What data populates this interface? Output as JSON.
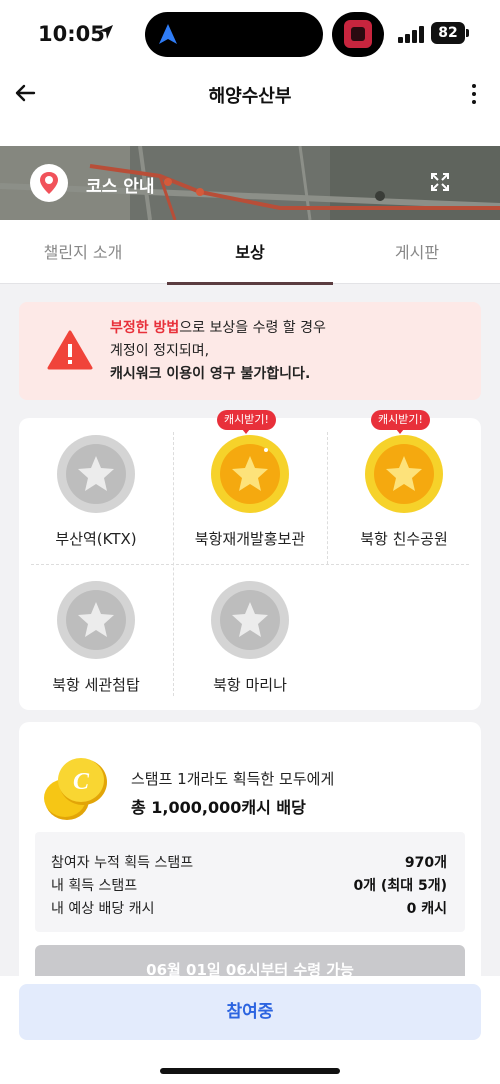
{
  "status_bar": {
    "time": "10:05",
    "battery": "82"
  },
  "header": {
    "title": "해양수산부"
  },
  "map_banner": {
    "label": "코스 안내"
  },
  "tabs": [
    {
      "label": "챌린지 소개",
      "active": false
    },
    {
      "label": "보상",
      "active": true
    },
    {
      "label": "게시판",
      "active": false
    }
  ],
  "warning": {
    "red": "부정한 방법",
    "line1_rest": "으로 보상을 수령 할 경우",
    "line2": "계정이 정지되며,",
    "line3": "캐시워크 이용이 영구 불가합니다."
  },
  "stamps": [
    {
      "label": "부산역(KTX)",
      "status": "locked",
      "badge": ""
    },
    {
      "label": "북항재개발홍보관",
      "status": "earned",
      "badge": "캐시받기!"
    },
    {
      "label": "북항 친수공원",
      "status": "earned",
      "badge": "캐시받기!"
    },
    {
      "label": "북항 세관첨탑",
      "status": "locked",
      "badge": ""
    },
    {
      "label": "북항 마리나",
      "status": "locked",
      "badge": ""
    }
  ],
  "reward": {
    "line1": "스탬프 1개라도 획득한 모두에게",
    "line2": "총 1,000,000캐시 배당",
    "stats": [
      {
        "key": "참여자 누적 획득 스탬프",
        "value": "970개"
      },
      {
        "key": "내 획득 스탬프",
        "value": "0개 (최대 5개)"
      },
      {
        "key": "내 예상 배당 캐시",
        "value": "0 캐시"
      }
    ],
    "claim_button": "06월 01일 06시부터 수령 가능"
  },
  "join_button": "참여중",
  "colors": {
    "accent_red": "#e8303a",
    "tab_indicator": "#5b3d40",
    "join_blue": "#2c64e0",
    "coin_gold": "#f6c615"
  }
}
